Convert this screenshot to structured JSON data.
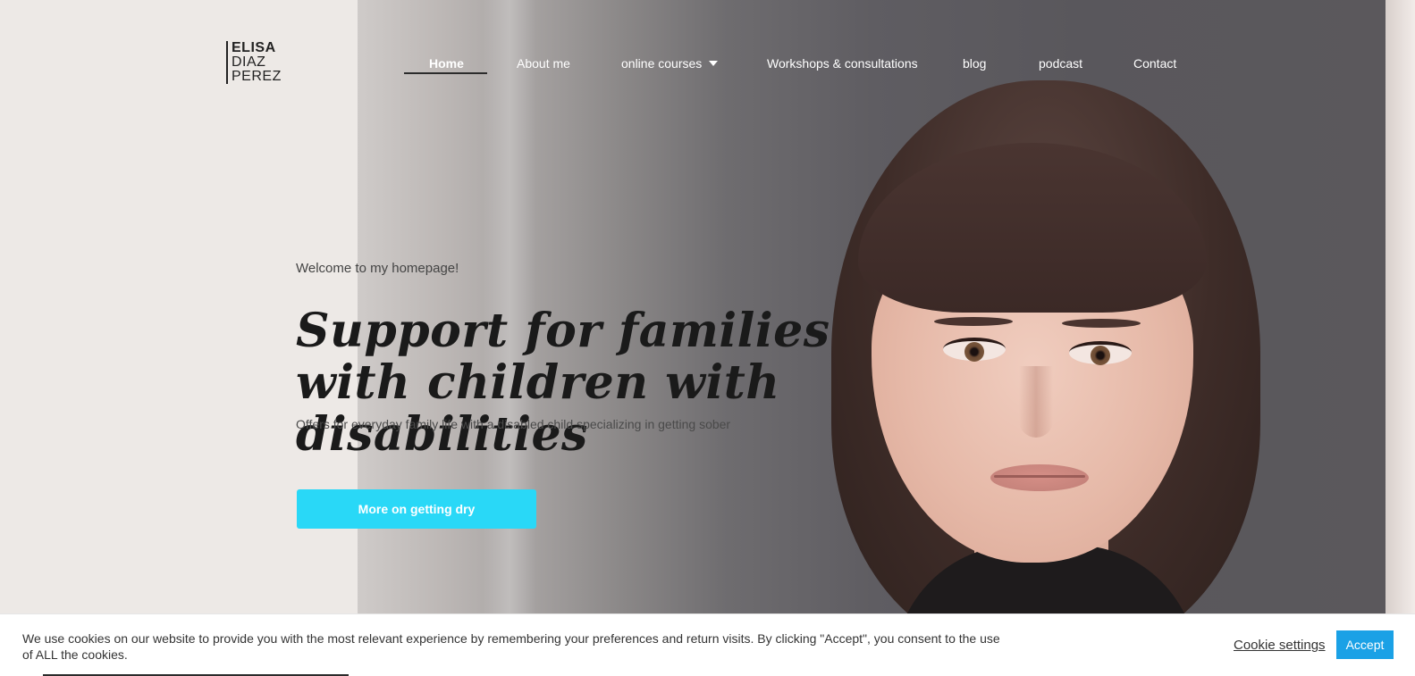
{
  "brand": {
    "line1": "ELISA",
    "line2": "DIAZ",
    "line3": "PEREZ"
  },
  "nav": {
    "items": [
      {
        "label": "Home",
        "active": true
      },
      {
        "label": "About me",
        "active": false
      },
      {
        "label": "online courses",
        "active": false,
        "has_dropdown": true
      },
      {
        "label": "Workshops & consultations",
        "active": false
      },
      {
        "label": "blog",
        "active": false
      },
      {
        "label": "podcast",
        "active": false
      },
      {
        "label": "Contact",
        "active": false
      }
    ]
  },
  "hero": {
    "welcome": "Welcome to my homepage!",
    "headline": "Support for families with children with disabilities",
    "subline": "Offers for everyday family life with a disabled child specializing in getting sober",
    "cta_label": "More on getting dry",
    "cta_color": "#29d8f7",
    "image_icon": "portrait-photo-icon"
  },
  "cookie_bar": {
    "text": "We use cookies on our website to provide you with the most relevant experience by remembering your preferences and return visits. By clicking \"Accept\", you consent to the use of ALL the cookies.",
    "settings_label": "Cookie settings",
    "accept_label": "Accept",
    "accept_color": "#1aa1e6"
  }
}
